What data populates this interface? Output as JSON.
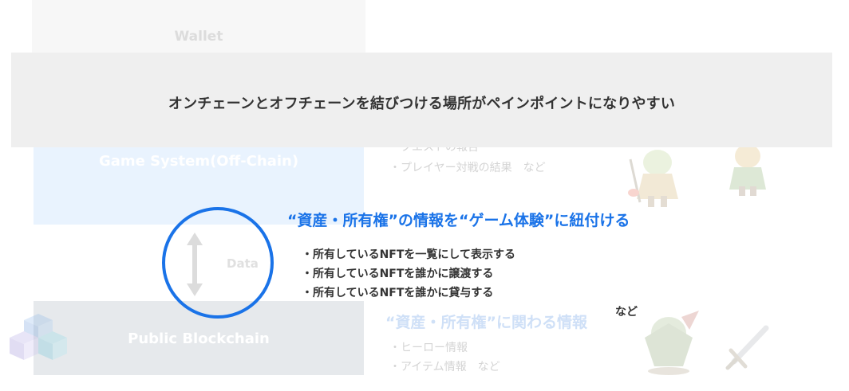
{
  "wallet": {
    "label": "Wallet"
  },
  "game_system": {
    "label": "Game System(Off-Chain)",
    "faded_items": [
      "・クエストの報告",
      "・プレイヤー対戦の結果　など"
    ]
  },
  "public_chain": {
    "label": "Public Blockchain",
    "faded_heading": "“資産・所有権”に関わる情報",
    "faded_items": [
      "・ヒーロー情報",
      "・アイテム情報　など"
    ]
  },
  "connector": {
    "label": "Data"
  },
  "banner": {
    "text": "オンチェーンとオフチェーンを結びつける場所がペインポイントになりやすい"
  },
  "highlight": {
    "headline": "“資産・所有権”の情報を“ゲーム体験”に紐付ける",
    "points": [
      "・所有しているNFTを一覧にして表示する",
      "・所有しているNFTを誰かに譲渡する",
      "・所有しているNFTを誰かに貸与する"
    ],
    "etc": "など"
  },
  "colors": {
    "accent": "#1a73e8",
    "banner_bg": "#efefef",
    "text": "#333333"
  }
}
